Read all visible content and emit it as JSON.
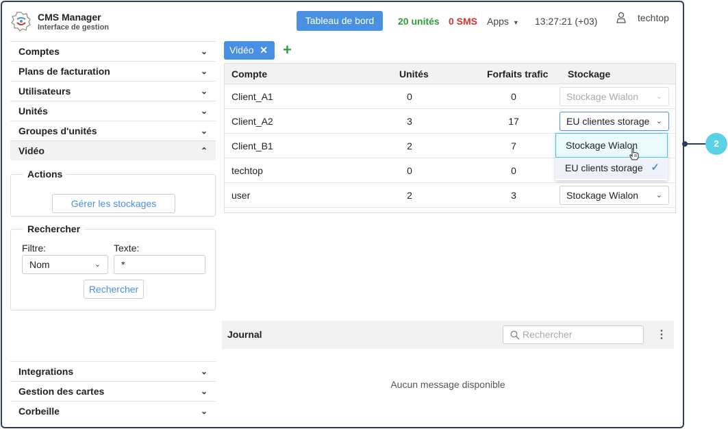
{
  "header": {
    "app_title": "CMS Manager",
    "app_subtitle": "Interface de gestion",
    "dashboard_button": "Tableau de bord",
    "units_status": "20 unités",
    "sms_status": "0 SMS",
    "apps_menu": "Apps",
    "clock": "13:27:21 (+03)",
    "username": "techtop"
  },
  "sidebar": {
    "items": [
      {
        "label": "Comptes",
        "icon": "chevron-down"
      },
      {
        "label": "Plans de facturation",
        "icon": "chevron-down"
      },
      {
        "label": "Utilisateurs",
        "icon": "chevron-down"
      },
      {
        "label": "Unités",
        "icon": "chevron-down"
      },
      {
        "label": "Groupes d'unités",
        "icon": "chevron-down"
      },
      {
        "label": "Vidéo",
        "icon": "chevron-up"
      }
    ],
    "actions": {
      "legend": "Actions",
      "manage_button": "Gérer les stockages"
    },
    "search": {
      "legend": "Rechercher",
      "filter_label": "Filtre:",
      "filter_value": "Nom",
      "text_label": "Texte:",
      "text_value": "*",
      "search_button": "Rechercher"
    },
    "bottom_items": [
      {
        "label": "Integrations",
        "icon": "chevron-down"
      },
      {
        "label": "Gestion des cartes",
        "icon": "chevron-down"
      },
      {
        "label": "Corbeille",
        "icon": "chevron-down"
      }
    ]
  },
  "main": {
    "tab_label": "Vidéo",
    "table": {
      "columns": [
        "Compte",
        "Unités",
        "Forfaits trafic",
        "Stockage"
      ],
      "rows": [
        {
          "account": "Client_A1",
          "units": "0",
          "traffic": "0",
          "storage": "Stockage Wialon",
          "state": "disabled"
        },
        {
          "account": "Client_A2",
          "units": "3",
          "traffic": "17",
          "storage": "EU clientes storage",
          "state": "focused"
        },
        {
          "account": "Client_B1",
          "units": "2",
          "traffic": "7",
          "storage": "",
          "state": "hidden"
        },
        {
          "account": "techtop",
          "units": "0",
          "traffic": "0",
          "storage": "",
          "state": "hidden"
        },
        {
          "account": "user",
          "units": "2",
          "traffic": "3",
          "storage": "Stockage Wialon",
          "state": "normal"
        }
      ]
    },
    "dropdown": {
      "options": [
        "Stockage Wialon",
        "EU clients storage"
      ],
      "hovered": "Stockage Wialon",
      "selected": "EU clients storage"
    },
    "callout_number": "2",
    "journal": {
      "title": "Journal",
      "search_placeholder": "Rechercher",
      "empty_message": "Aucun message disponible"
    }
  },
  "colors": {
    "accent": "#4a90e2",
    "units_green": "#2e9e3d",
    "sms_red": "#d6312a",
    "frame": "#2e3a5c",
    "callout": "#5bd0e6"
  }
}
